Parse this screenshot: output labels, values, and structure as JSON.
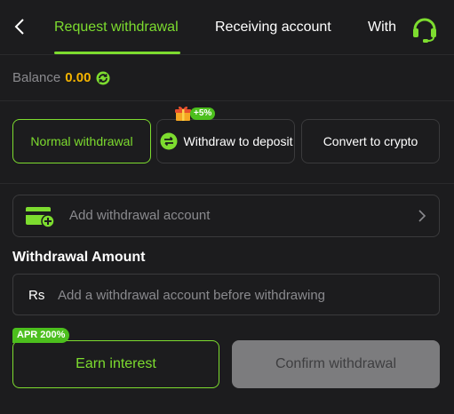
{
  "header": {
    "tabs": [
      {
        "label": "Request withdrawal",
        "active": true
      },
      {
        "label": "Receiving account",
        "active": false
      },
      {
        "label": "With",
        "active": false
      }
    ]
  },
  "balance": {
    "label": "Balance",
    "value": "0.00"
  },
  "methods": {
    "normal": "Normal withdrawal",
    "deposit": "Withdraw to deposit",
    "deposit_badge": "+5%",
    "crypto": "Convert to crypto"
  },
  "account": {
    "add_label": "Add withdrawal account"
  },
  "amount": {
    "title": "Withdrawal Amount",
    "currency": "Rs",
    "placeholder": "Add a withdrawal account before withdrawing",
    "value": ""
  },
  "actions": {
    "apr_badge": "APR 200%",
    "earn_label": "Earn interest",
    "confirm_label": "Confirm withdrawal"
  },
  "colors": {
    "accent": "#7ddc2f",
    "balance": "#f5b400",
    "background": "#1c1c1e",
    "disabled_button": "#7c7c7e"
  },
  "icons": [
    "back-arrow-icon",
    "headset-icon",
    "refresh-icon",
    "gift-icon",
    "swap-icon",
    "wallet-add-icon",
    "chevron-right-icon"
  ]
}
